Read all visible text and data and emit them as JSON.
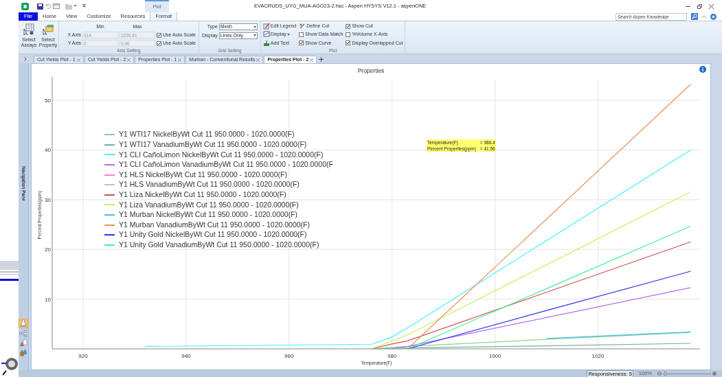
{
  "window": {
    "title": "EVACRUDS_UYG_MUA-AGO23-2.hsc - Aspen HYSYS V12.1 - aspenONE",
    "contextual_tab": "Plot"
  },
  "ribbon_tabs": [
    {
      "label": "File",
      "kind": "file",
      "selected": false
    },
    {
      "label": "Home",
      "kind": "tab",
      "selected": false
    },
    {
      "label": "View",
      "kind": "tab",
      "selected": false
    },
    {
      "label": "Customize",
      "kind": "tab",
      "selected": false
    },
    {
      "label": "Resources",
      "kind": "tab",
      "selected": false
    },
    {
      "label": "Format",
      "kind": "tab",
      "selected": true
    }
  ],
  "search": {
    "placeholder": "Search Aspen Knowledge"
  },
  "ribbon": {
    "large_buttons": [
      {
        "label": "Select Assays"
      },
      {
        "label": "Select Property"
      }
    ],
    "axis_setting": {
      "title": "Axis Setting",
      "min_label": "Min",
      "max_label": "Max",
      "rows": [
        {
          "label": "X Axis",
          "min": "914",
          "max": "1039.81",
          "disabled": true,
          "auto_scale": {
            "label": "Use Auto Scale",
            "checked": true
          }
        },
        {
          "label": "Y Axis",
          "min": "0",
          "max": "9.96",
          "disabled": true,
          "auto_scale": {
            "label": "Use Auto Scale",
            "checked": true
          }
        }
      ]
    },
    "grid_setting": {
      "title": "Grid Setting",
      "selects": [
        {
          "label": "Type",
          "value": "Mesh"
        },
        {
          "label": "Display",
          "value": "Lines Only"
        }
      ]
    },
    "plot": {
      "title": "Plot",
      "items": [
        {
          "kind": "command",
          "label": "Edit Legend",
          "dropdown": false
        },
        {
          "kind": "command",
          "label": "Display",
          "dropdown": true
        },
        {
          "kind": "command",
          "label": "Add Text",
          "dropdown": false
        },
        {
          "kind": "command",
          "label": "Define Cut",
          "dropdown": false
        },
        {
          "kind": "checkbox",
          "label": "Show Data Match",
          "checked": false
        },
        {
          "kind": "checkbox",
          "label": "Show Curve",
          "checked": true
        },
        {
          "kind": "checkbox",
          "label": "Show Cut",
          "checked": true
        },
        {
          "kind": "checkbox",
          "label": "%Volume X-Axis",
          "checked": false
        },
        {
          "kind": "checkbox",
          "label": "Display Overlapped Cut",
          "checked": true
        }
      ]
    }
  },
  "document_tabs": [
    {
      "label": "Cut Yields Plot - 1",
      "selected": false
    },
    {
      "label": "Cut Yields Plot - 2",
      "selected": false
    },
    {
      "label": "Properties Plot - 1",
      "selected": false
    },
    {
      "label": "Murban - Conventional Results",
      "selected": false
    },
    {
      "label": "Properties Plot - 2",
      "selected": true
    }
  ],
  "navigation_pane": {
    "label": "Navigation Pane"
  },
  "chart": {
    "tooltip": [
      {
        "label": "Temperature(F)",
        "value": "= 986.4"
      },
      {
        "label": "Percent Properties(ppm)",
        "value": "= 41.56"
      }
    ],
    "chart_data": {
      "type": "line",
      "title": "Properties",
      "xlabel": "Temperature(F)",
      "ylabel": "Percent Properties(ppm)",
      "x": [
        932,
        976,
        980,
        983,
        1010,
        1038
      ],
      "series": [
        {
          "name": "Y1 WTI17 NickelByWt Cut 11 950.0000 - 1020.0000(F)",
          "color": "#90d090",
          "values": [
            null,
            0,
            0.3,
            0.5,
            1.9,
            3.3
          ]
        },
        {
          "name": "Y1 WTI17 VanadiumByWt Cut 11 950.0000 - 1020.0000(F)",
          "color": "#70b0a0",
          "values": [
            null,
            0,
            0.1,
            0.2,
            0.6,
            1.1
          ]
        },
        {
          "name": "Y1 CLI CañoLimon NickelByWt Cut 11 950.0000 - 1020.0000(F)",
          "color": "#40f0ff",
          "values": [
            0.5,
            0.9,
            2.4,
            4.2,
            21.8,
            40.0
          ]
        },
        {
          "name": "Y1 CLI CañoLimon VanadiumByWt Cut 11 950.0000 - 1020.0000(F",
          "color": "#b070f0",
          "values": [
            null,
            null,
            0,
            0.5,
            6.3,
            12.3
          ]
        },
        {
          "name": "Y1 HLS NickelByWt Cut 11 950.0000 - 1020.0000(F)",
          "color": "#ff80c0",
          "values": [
            null,
            null,
            null,
            null,
            null,
            null
          ]
        },
        {
          "name": "Y1 HLS VanadiumByWt Cut 11 950.0000 - 1020.0000(F)",
          "color": "#c0c0c0",
          "values": [
            null,
            null,
            null,
            null,
            null,
            null
          ]
        },
        {
          "name": "Y1 Liza NickelByWt Cut 11 950.0000 - 1020.0000(F)",
          "color": "#d05050",
          "values": [
            null,
            0,
            1.0,
            1.6,
            11.4,
            21.5
          ]
        },
        {
          "name": "Y1 Liza VanadiumByWt Cut 11 950.0000 - 1020.0000(F)",
          "color": "#c8f060",
          "values": [
            null,
            0,
            1.6,
            2.8,
            16.9,
            31.6
          ]
        },
        {
          "name": "Y1 Murban NickelByWt Cut 11 950.0000 - 1020.0000(F)",
          "color": "#40c0f0",
          "values": [
            null,
            null,
            null,
            null,
            2.1,
            3.4
          ]
        },
        {
          "name": "Y1 Murban VanadiumByWt Cut 11 950.0000 - 1020.0000(F)",
          "color": "#e8905a",
          "values": [
            null,
            null,
            null,
            0,
            26.1,
            53.2
          ]
        },
        {
          "name": "Y1 Unity Gold NickelByWt Cut 11 950.0000 - 1020.0000(F)",
          "color": "#3030f0",
          "values": [
            null,
            null,
            null,
            0,
            7.7,
            15.6
          ]
        },
        {
          "name": "Y1 Unity Gold VanadiumByWt Cut 11 950.0000 - 1020.0000(F)",
          "color": "#40f0a0",
          "values": [
            null,
            null,
            null,
            0,
            12.1,
            24.7
          ]
        }
      ],
      "xlim": [
        914,
        1039.81
      ],
      "ylim": [
        0,
        54
      ],
      "grid": true,
      "legend": true,
      "xticks": [
        920,
        940,
        960,
        980,
        1000,
        1020
      ],
      "yticks": [
        10,
        20,
        30,
        40,
        50
      ]
    }
  },
  "status_bar": {
    "responsiveness": "Responsiveness: 5",
    "zoom": "100%",
    "zoom_slider": {
      "level": 0.03
    }
  }
}
